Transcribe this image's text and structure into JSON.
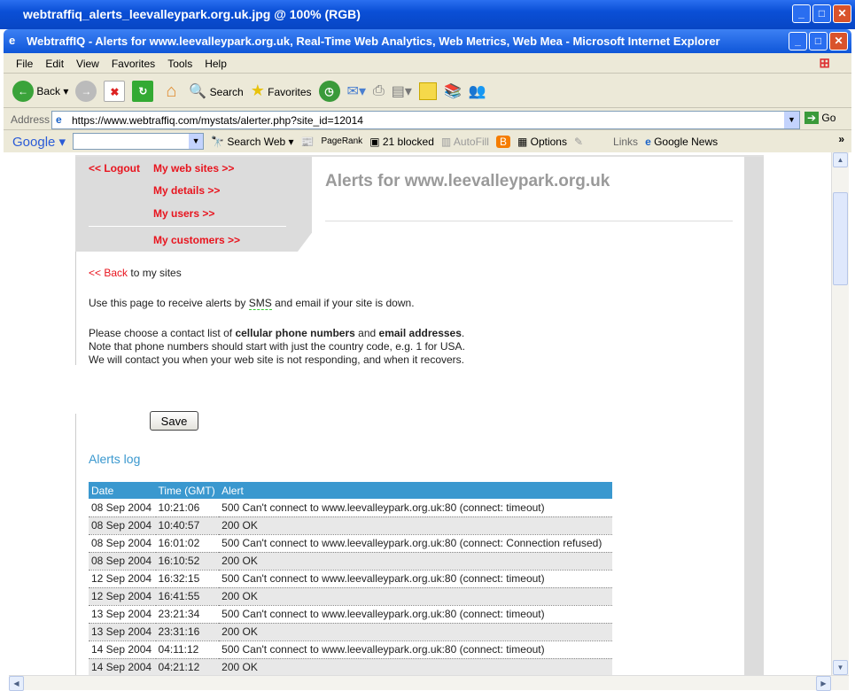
{
  "outer_window": {
    "title": "webtraffiq_alerts_leevalleypark.org.uk.jpg @ 100% (RGB)"
  },
  "browser": {
    "title": "WebtraffIQ - Alerts for www.leevalleypark.org.uk, Real-Time Web Analytics, Web Metrics, Web Mea - Microsoft Internet Explorer",
    "menu": [
      "File",
      "Edit",
      "View",
      "Favorites",
      "Tools",
      "Help"
    ],
    "toolbar": {
      "back": "Back",
      "search": "Search",
      "favorites": "Favorites"
    },
    "address": {
      "label": "Address",
      "url": "https://www.webtraffiq.com/mystats/alerter.php?site_id=12014",
      "go": "Go"
    },
    "google_bar": {
      "logo": "Google",
      "search_web": "Search Web",
      "pagerank": "PageRank",
      "blocked": "21 blocked",
      "autofill": "AutoFill",
      "options": "Options",
      "links": "Links",
      "google_news": "Google News"
    }
  },
  "nav": {
    "logout": "<< Logout",
    "my_web_sites": "My web sites >>",
    "my_details": "My details >>",
    "my_users": "My users >>",
    "my_customers": "My customers >>"
  },
  "page": {
    "title": "Alerts for www.leevalleypark.org.uk",
    "back_link": "<< Back",
    "back_suffix": " to my sites",
    "intro_pre": "Use this page to receive alerts by ",
    "intro_sms": "SMS",
    "intro_post": " and email if your site is down.",
    "p1_pre": "Please choose a contact list of ",
    "p1_b1": "cellular phone numbers",
    "p1_mid": " and ",
    "p1_b2": "email addresses",
    "p1_end": ".",
    "p2": "Note that phone numbers should start with just the country code, e.g. 1 for USA.",
    "p3": "We will contact you when your web site is not responding, and when it recovers.",
    "save": "Save",
    "log_title": "Alerts log"
  },
  "log": {
    "headers": [
      "Date",
      "Time (GMT)",
      "Alert"
    ],
    "rows": [
      [
        "08 Sep 2004",
        "10:21:06",
        "500 Can't connect to www.leevalleypark.org.uk:80 (connect: timeout)"
      ],
      [
        "08 Sep 2004",
        "10:40:57",
        "200 OK"
      ],
      [
        "08 Sep 2004",
        "16:01:02",
        "500 Can't connect to www.leevalleypark.org.uk:80 (connect: Connection refused)"
      ],
      [
        "08 Sep 2004",
        "16:10:52",
        "200 OK"
      ],
      [
        "12 Sep 2004",
        "16:32:15",
        "500 Can't connect to www.leevalleypark.org.uk:80 (connect: timeout)"
      ],
      [
        "12 Sep 2004",
        "16:41:55",
        "200 OK"
      ],
      [
        "13 Sep 2004",
        "23:21:34",
        "500 Can't connect to www.leevalleypark.org.uk:80 (connect: timeout)"
      ],
      [
        "13 Sep 2004",
        "23:31:16",
        "200 OK"
      ],
      [
        "14 Sep 2004",
        "04:11:12",
        "500 Can't connect to www.leevalleypark.org.uk:80 (connect: timeout)"
      ],
      [
        "14 Sep 2004",
        "04:21:12",
        "200 OK"
      ]
    ]
  }
}
